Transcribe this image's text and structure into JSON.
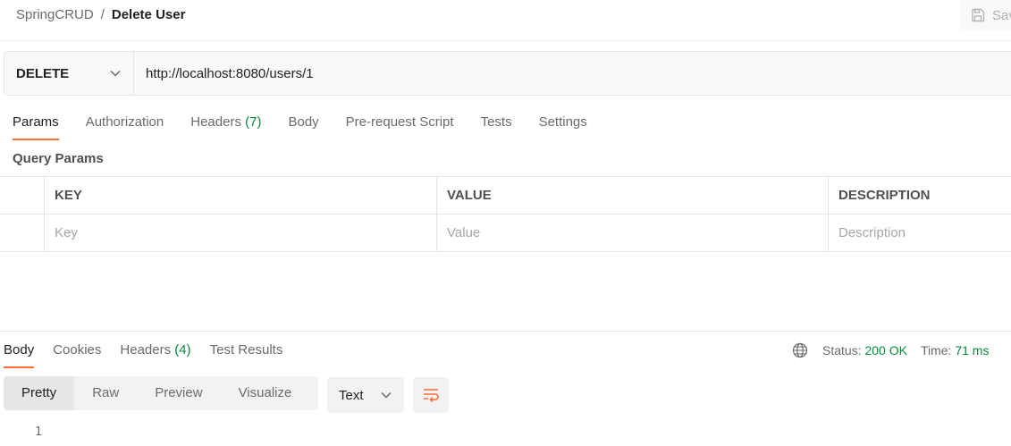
{
  "header": {
    "collection": "SpringCRUD",
    "separator": "/",
    "request_name": "Delete User",
    "save_label": "Save",
    "save_icon": "save-icon"
  },
  "request": {
    "method": "DELETE",
    "url": "http://localhost:8080/users/1"
  },
  "request_tabs": {
    "params": "Params",
    "authorization": "Authorization",
    "headers": "Headers",
    "headers_count": "(7)",
    "body": "Body",
    "prerequest": "Pre-request Script",
    "tests": "Tests",
    "settings": "Settings"
  },
  "query_params": {
    "title": "Query Params",
    "columns": {
      "key": "KEY",
      "value": "VALUE",
      "description": "DESCRIPTION"
    },
    "placeholders": {
      "key": "Key",
      "value": "Value",
      "description": "Description"
    }
  },
  "response_tabs": {
    "body": "Body",
    "cookies": "Cookies",
    "headers": "Headers",
    "headers_count": "(4)",
    "test_results": "Test Results"
  },
  "response_status": {
    "status_label": "Status:",
    "status_value": "200 OK",
    "time_label": "Time:",
    "time_value": "71 ms",
    "globe_icon": "globe-icon"
  },
  "response_view": {
    "modes": [
      "Pretty",
      "Raw",
      "Preview",
      "Visualize"
    ],
    "format": "Text",
    "wrap_icon": "wrap-lines-icon",
    "line_number": "1"
  },
  "colors": {
    "accent": "#ff6c37",
    "success": "#0c8a3c"
  }
}
